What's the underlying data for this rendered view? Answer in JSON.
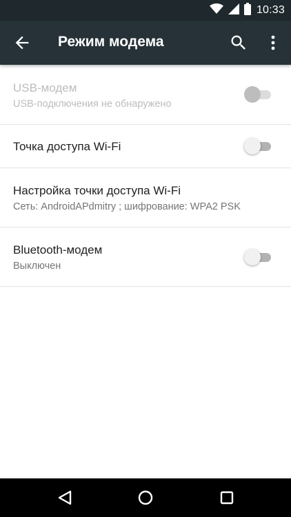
{
  "status_bar": {
    "time": "10:33",
    "icons": [
      "wifi-signal-icon",
      "cell-signal-icon",
      "battery-icon"
    ]
  },
  "app_bar": {
    "title": "Режим модема",
    "back_icon": "arrow-back-icon",
    "search_icon": "search-icon",
    "menu_icon": "more-vert-icon"
  },
  "settings": {
    "usb": {
      "title": "USB-модем",
      "summary": "USB-подключения не обнаружено",
      "enabled": false,
      "checked": false
    },
    "wifi_hotspot": {
      "title": "Точка доступа Wi-Fi",
      "enabled": true,
      "checked": false
    },
    "hotspot_config": {
      "title": "Настройка точки доступа Wi-Fi",
      "summary": "Сеть: AndroidAPdmitry ; шифрование: WPA2 PSK"
    },
    "bluetooth": {
      "title": "Bluetooth-модем",
      "summary": "Выключен",
      "enabled": true,
      "checked": false
    }
  },
  "nav_bar": {
    "icons": [
      "nav-back-icon",
      "nav-home-icon",
      "nav-recents-icon"
    ]
  },
  "colors": {
    "status_bar": "#1f282c",
    "app_bar": "#263238",
    "text_primary": "#212121",
    "text_secondary": "#757575",
    "text_disabled": "#bdbdbd",
    "divider": "#e4e4e4"
  }
}
